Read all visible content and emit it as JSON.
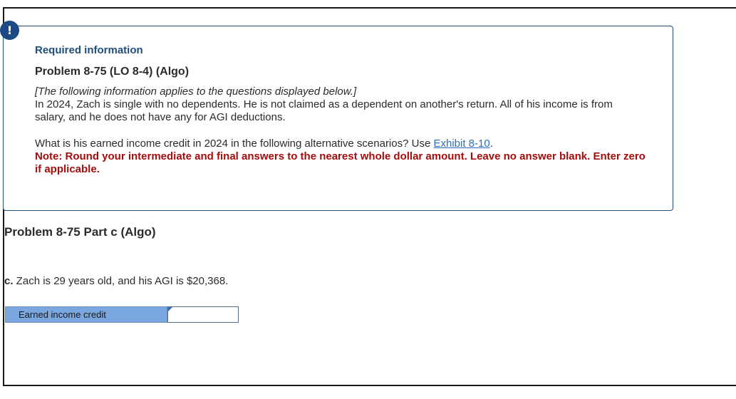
{
  "alert": {
    "symbol": "!"
  },
  "info": {
    "required_title": "Required information",
    "problem_heading": "Problem 8-75 (LO 8-4) (Algo)",
    "intro_italic": "[The following information applies to the questions displayed below.]",
    "intro_text": "In 2024, Zach is single with no dependents. He is not claimed as a dependent on another's return. All of his income is from salary, and he does not have any for AGI deductions.",
    "question_text": "What is his earned income credit in 2024 in the following alternative scenarios? Use ",
    "exhibit_link": "Exhibit 8-10",
    "question_suffix": ".",
    "note": "Note: Round your intermediate and final answers to the nearest whole dollar amount. Leave no answer blank. Enter zero if applicable."
  },
  "part": {
    "heading": "Problem 8-75 Part c (Algo)",
    "prefix": "c.",
    "text": " Zach is 29 years old, and his AGI is $20,368."
  },
  "answer": {
    "label": "Earned income credit",
    "value": ""
  }
}
